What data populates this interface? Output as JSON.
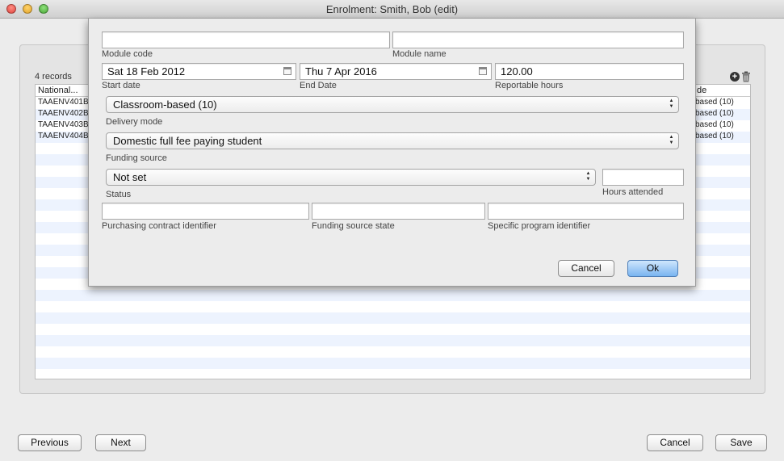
{
  "window": {
    "title": "Enrolment: Smith, Bob (edit)"
  },
  "list": {
    "count_label": "4 records",
    "columns": {
      "national": "National...",
      "mode": "de"
    },
    "rows": [
      {
        "code": "TAAENV401B",
        "mode": "based (10)"
      },
      {
        "code": "TAAENV402B",
        "mode": "based (10)"
      },
      {
        "code": "TAAENV403B",
        "mode": "based (10)"
      },
      {
        "code": "TAAENV404B",
        "mode": "based (10)"
      }
    ]
  },
  "footer": {
    "previous": "Previous",
    "next": "Next",
    "cancel": "Cancel",
    "save": "Save"
  },
  "dialog": {
    "module_code": {
      "value": "",
      "label": "Module code"
    },
    "module_name": {
      "value": "",
      "label": "Module name"
    },
    "start_date": {
      "value": "Sat 18 Feb 2012",
      "label": "Start date"
    },
    "end_date": {
      "value": "Thu 7 Apr 2016",
      "label": "End Date"
    },
    "reportable_hours": {
      "value": "120.00",
      "label": "Reportable hours"
    },
    "delivery_mode": {
      "value": "Classroom-based (10)",
      "label": "Delivery mode"
    },
    "funding_source": {
      "value": "Domestic full fee paying student",
      "label": "Funding source"
    },
    "status": {
      "value": "Not set",
      "label": "Status"
    },
    "hours_attended": {
      "value": "",
      "label": "Hours attended"
    },
    "purchasing_contract": {
      "value": "",
      "label": "Purchasing contract identifier"
    },
    "funding_source_state": {
      "value": "",
      "label": "Funding source state"
    },
    "specific_program": {
      "value": "",
      "label": "Specific program identifier"
    },
    "cancel": "Cancel",
    "ok": "Ok"
  }
}
